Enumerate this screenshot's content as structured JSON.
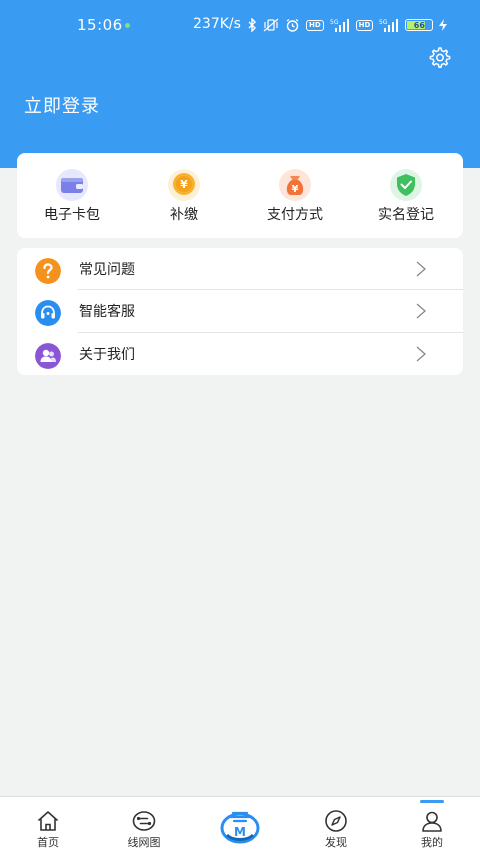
{
  "status_bar": {
    "time": "15:06",
    "network_speed": "237K/s",
    "hd1": "HD",
    "hd2": "HD",
    "battery_level": "66",
    "icons": [
      "bluetooth-icon",
      "vibrate-off-icon",
      "alarm-icon",
      "signal-5g-icon",
      "signal-5g-icon",
      "charging-icon"
    ]
  },
  "header": {
    "login_label": "立即登录",
    "settings_icon": "gear-icon",
    "background_color": "#3a9bf2"
  },
  "quick_actions": [
    {
      "label": "电子卡包",
      "icon": "wallet-icon"
    },
    {
      "label": "补缴",
      "icon": "yen-coin-icon"
    },
    {
      "label": "支付方式",
      "icon": "money-bag-icon"
    },
    {
      "label": "实名登记",
      "icon": "shield-check-icon"
    }
  ],
  "menu": [
    {
      "label": "常见问题",
      "icon": "question-icon",
      "color": "#f5921e"
    },
    {
      "label": "智能客服",
      "icon": "headset-icon",
      "color": "#2a8ef0"
    },
    {
      "label": "关于我们",
      "icon": "users-icon",
      "color": "#8a56d6"
    }
  ],
  "tabbar": {
    "tabs": [
      {
        "label": "首页",
        "icon": "home-icon"
      },
      {
        "label": "线网图",
        "icon": "route-map-icon"
      },
      {
        "label": "",
        "icon": "metro-logo-icon"
      },
      {
        "label": "发现",
        "icon": "compass-icon"
      },
      {
        "label": "我的",
        "icon": "user-icon"
      }
    ],
    "active": "我的"
  }
}
